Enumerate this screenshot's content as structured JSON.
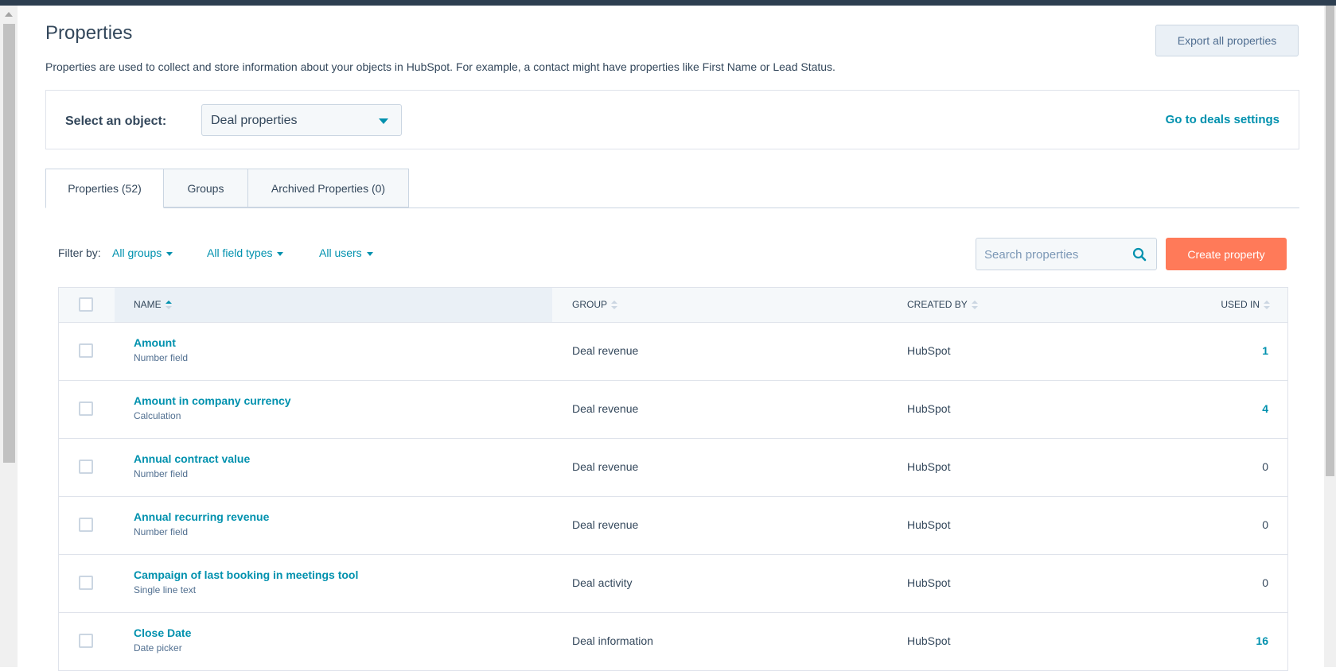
{
  "header": {
    "title": "Properties",
    "description": "Properties are used to collect and store information about your objects in HubSpot. For example, a contact might have properties like First Name or Lead Status.",
    "export_label": "Export all properties"
  },
  "object_panel": {
    "label": "Select an object:",
    "selected": "Deal properties",
    "settings_link": "Go to deals settings"
  },
  "tabs": [
    {
      "label": "Properties (52)",
      "active": true
    },
    {
      "label": "Groups",
      "active": false
    },
    {
      "label": "Archived Properties (0)",
      "active": false
    }
  ],
  "filters": {
    "label": "Filter by:",
    "groups": "All groups",
    "field_types": "All field types",
    "users": "All users"
  },
  "search": {
    "placeholder": "Search properties",
    "value": ""
  },
  "create_label": "Create property",
  "table": {
    "columns": {
      "name": "NAME",
      "group": "GROUP",
      "created_by": "CREATED BY",
      "used_in": "USED IN"
    },
    "rows": [
      {
        "name": "Amount",
        "type": "Number field",
        "group": "Deal revenue",
        "created_by": "HubSpot",
        "used_in": "1"
      },
      {
        "name": "Amount in company currency",
        "type": "Calculation",
        "group": "Deal revenue",
        "created_by": "HubSpot",
        "used_in": "4"
      },
      {
        "name": "Annual contract value",
        "type": "Number field",
        "group": "Deal revenue",
        "created_by": "HubSpot",
        "used_in": "0"
      },
      {
        "name": "Annual recurring revenue",
        "type": "Number field",
        "group": "Deal revenue",
        "created_by": "HubSpot",
        "used_in": "0"
      },
      {
        "name": "Campaign of last booking in meetings tool",
        "type": "Single line text",
        "group": "Deal activity",
        "created_by": "HubSpot",
        "used_in": "0"
      },
      {
        "name": "Close Date",
        "type": "Date picker",
        "group": "Deal information",
        "created_by": "HubSpot",
        "used_in": "16"
      }
    ]
  },
  "colors": {
    "accent": "#0091ae",
    "primary_button": "#ff7a59",
    "top_bar": "#2d3e50"
  }
}
